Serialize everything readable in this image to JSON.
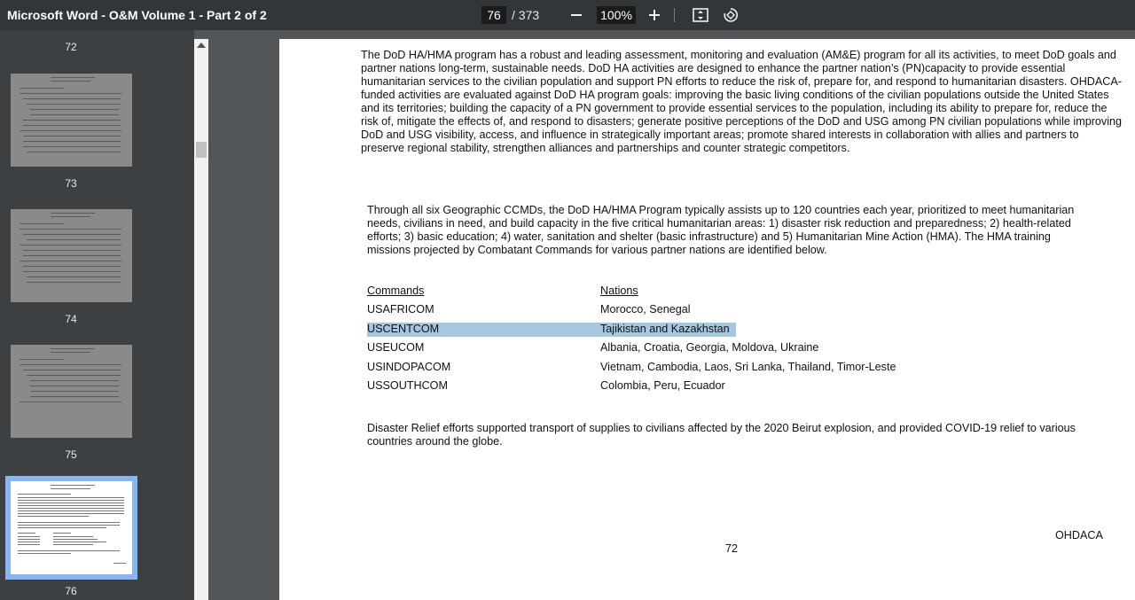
{
  "toolbar": {
    "title": "Microsoft Word - O&M Volume 1 - Part 2 of 2",
    "current_page": "76",
    "total_pages": "/ 373",
    "zoom": "100%",
    "icons": [
      "zoom-out-icon",
      "zoom-in-icon",
      "fit-page-icon",
      "rotate-icon"
    ]
  },
  "sidebar": {
    "thumbnails": [
      {
        "label": "72"
      },
      {
        "label": "73"
      },
      {
        "label": "74"
      },
      {
        "label": "75"
      },
      {
        "label": "76"
      }
    ]
  },
  "document": {
    "para1": "The DoD HA/HMA program has a robust and leading assessment, monitoring and evaluation (AM&E) program for all its activities, to meet DoD goals and partner nations long-term, sustainable needs. DoD HA activities are designed to enhance the partner nation’s (PN)capacity to provide essential humanitarian services to the civilian population and support PN efforts to reduce the risk of, prepare for, and respond to humanitarian disasters. OHDACA-funded activities are evaluated against DoD HA program goals: improving the basic living conditions of the civilian populations outside the United States and its territories; building the capacity of a PN government to provide essential services to the population, including its ability to prepare for, reduce the risk of, mitigate the effects of, and respond to disasters; generate positive perceptions of the DoD and USG among PN civilian populations while improving DoD and USG visibility, access, and influence in strategically important areas; promote shared interests in collaboration with allies and partners to preserve regional stability, strengthen alliances and partnerships and counter strategic competitors.",
    "para2": "Through all six Geographic CCMDs, the DoD HA/HMA Program typically assists up to 120 countries each year, prioritized to meet humanitarian needs, civilians in need, and build capacity in the five critical humanitarian areas: 1) disaster risk reduction and preparedness; 2) health-related efforts; 3) basic education; 4) water, sanitation and shelter (basic infrastructure) and 5) Humanitarian Mine Action (HMA). The HMA training missions projected by Combatant Commands for various partner nations are identified below.",
    "table_headers": {
      "commands": "Commands",
      "nations": "Nations"
    },
    "table_rows": [
      {
        "command": "USAFRICOM",
        "nations": "Morocco, Senegal"
      },
      {
        "command": "USCENTCOM",
        "nations": "Tajikistan and Kazakhstan"
      },
      {
        "command": "USEUCOM",
        "nations": "Albania, Croatia, Georgia, Moldova, Ukraine"
      },
      {
        "command": "USINDOPACOM",
        "nations": "Vietnam, Cambodia, Laos, Sri Lanka, Thailand, Timor-Leste"
      },
      {
        "command": "USSOUTHCOM",
        "nations": "Colombia, Peru, Ecuador"
      }
    ],
    "highlighted_row": 1,
    "para3": "Disaster Relief efforts supported transport of supplies to civilians affected by the 2020 Beirut explosion, and provided COVID-19 relief to various countries around the globe.",
    "footer_label": "OHDACA",
    "page_number": "72"
  },
  "colors": {
    "toolbar_bg": "#323639",
    "sidebar_bg": "#3c4043",
    "viewer_bg": "#525659",
    "selection": "#a6c7e0",
    "current_thumb_border": "#8ab4f8"
  }
}
